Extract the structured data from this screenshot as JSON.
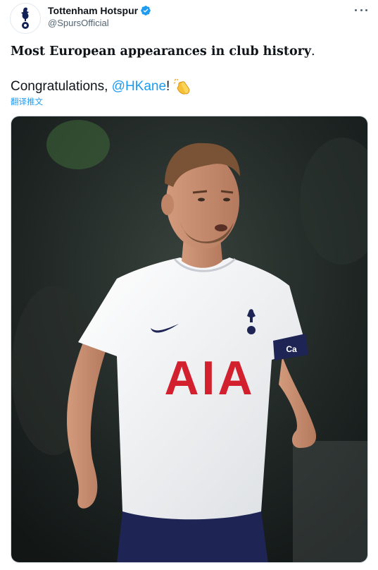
{
  "tweet": {
    "author": {
      "display_name": "Tottenham Hotspur",
      "handle": "@SpursOfficial",
      "verified": true,
      "avatar_icon": "spurs-cockerel-icon"
    },
    "text_line1": "Most European appearances in club history",
    "text_line1_end": ".",
    "text_line2_prefix": "Congratulations, ",
    "text_line2_mention": "@HKane",
    "text_line2_suffix": "!",
    "emoji_icon": "clapping-hands-icon",
    "translate_label": "翻译推文",
    "more_icon": "more-options-icon",
    "media": {
      "shirt_sponsor": "AIA",
      "armband_text": "Ca"
    }
  },
  "colors": {
    "accent": "#1d9bf0",
    "text": "#0f1419",
    "secondary_text": "#536471",
    "sponsor_red": "#d3202f",
    "shorts_navy": "#1e2554"
  }
}
